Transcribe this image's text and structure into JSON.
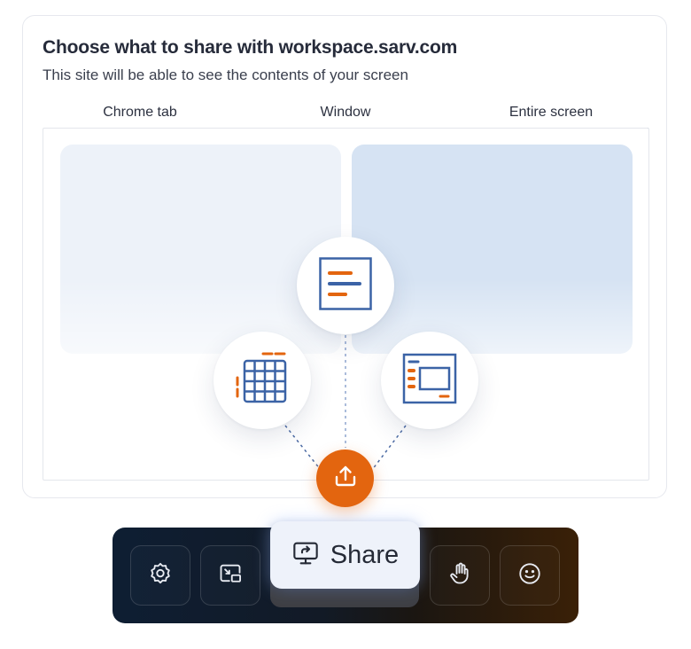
{
  "dialog": {
    "title": "Choose what to share with workspace.sarv.com",
    "subtitle": "This site will be able to see the contents of your screen",
    "tabs": [
      {
        "label": "Chrome tab",
        "active": false
      },
      {
        "label": "Window",
        "active": false
      },
      {
        "label": "Entire screen",
        "active": true
      }
    ]
  },
  "icons": {
    "document": "document-icon",
    "grid": "grid-table-icon",
    "window": "window-layout-icon",
    "upload": "upload-icon"
  },
  "toolbar": {
    "buttons": [
      {
        "icon": "settings-gear-icon"
      },
      {
        "icon": "picture-in-picture-icon"
      },
      {
        "icon": "raise-hand-icon"
      },
      {
        "icon": "smiley-icon"
      }
    ],
    "share": {
      "label": "Share",
      "icon": "screen-share-icon"
    }
  },
  "colors": {
    "accent_orange": "#e3650f",
    "accent_blue": "#3b63a6",
    "title_text": "#262b3a",
    "active_tab_underline": "#4b6aa3"
  }
}
